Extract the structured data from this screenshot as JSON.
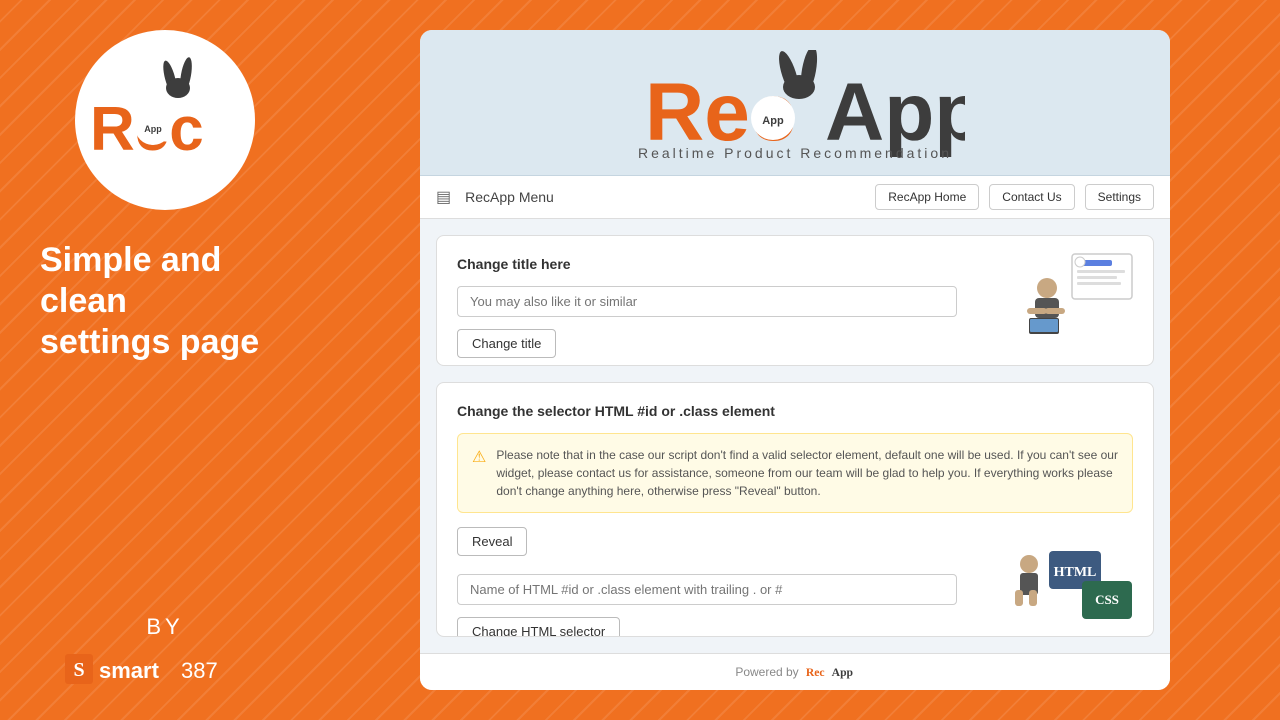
{
  "sidebar": {
    "tagline_line1": "Simple and",
    "tagline_line2": "clean",
    "tagline_line3": "settings page",
    "by_label": "BY",
    "brand_name": "smart387"
  },
  "app": {
    "subtitle": "Realtime Product Recommendation",
    "nav": {
      "menu_icon": "▤",
      "menu_label": "RecApp Menu",
      "home_button": "RecApp Home",
      "contact_button": "Contact Us",
      "settings_button": "Settings"
    },
    "section1": {
      "title": "Change title here",
      "input_placeholder": "You may also like it or similar",
      "button_label": "Change title"
    },
    "section2": {
      "title": "Change the selector HTML #id or .class element",
      "warning_text": "Please note that in the case our script don't find a valid selector element, default one will be used. If you can't see our widget, please contact us for assistance, someone from our team will be glad to help you. If everything works please don't change anything here, otherwise press \"Reveal\" button.",
      "reveal_button": "Reveal",
      "input_placeholder": "Name of HTML #id or .class element with trailing . or #",
      "change_button": "Change HTML selector"
    },
    "footer": {
      "powered_by": "Powered by"
    }
  }
}
